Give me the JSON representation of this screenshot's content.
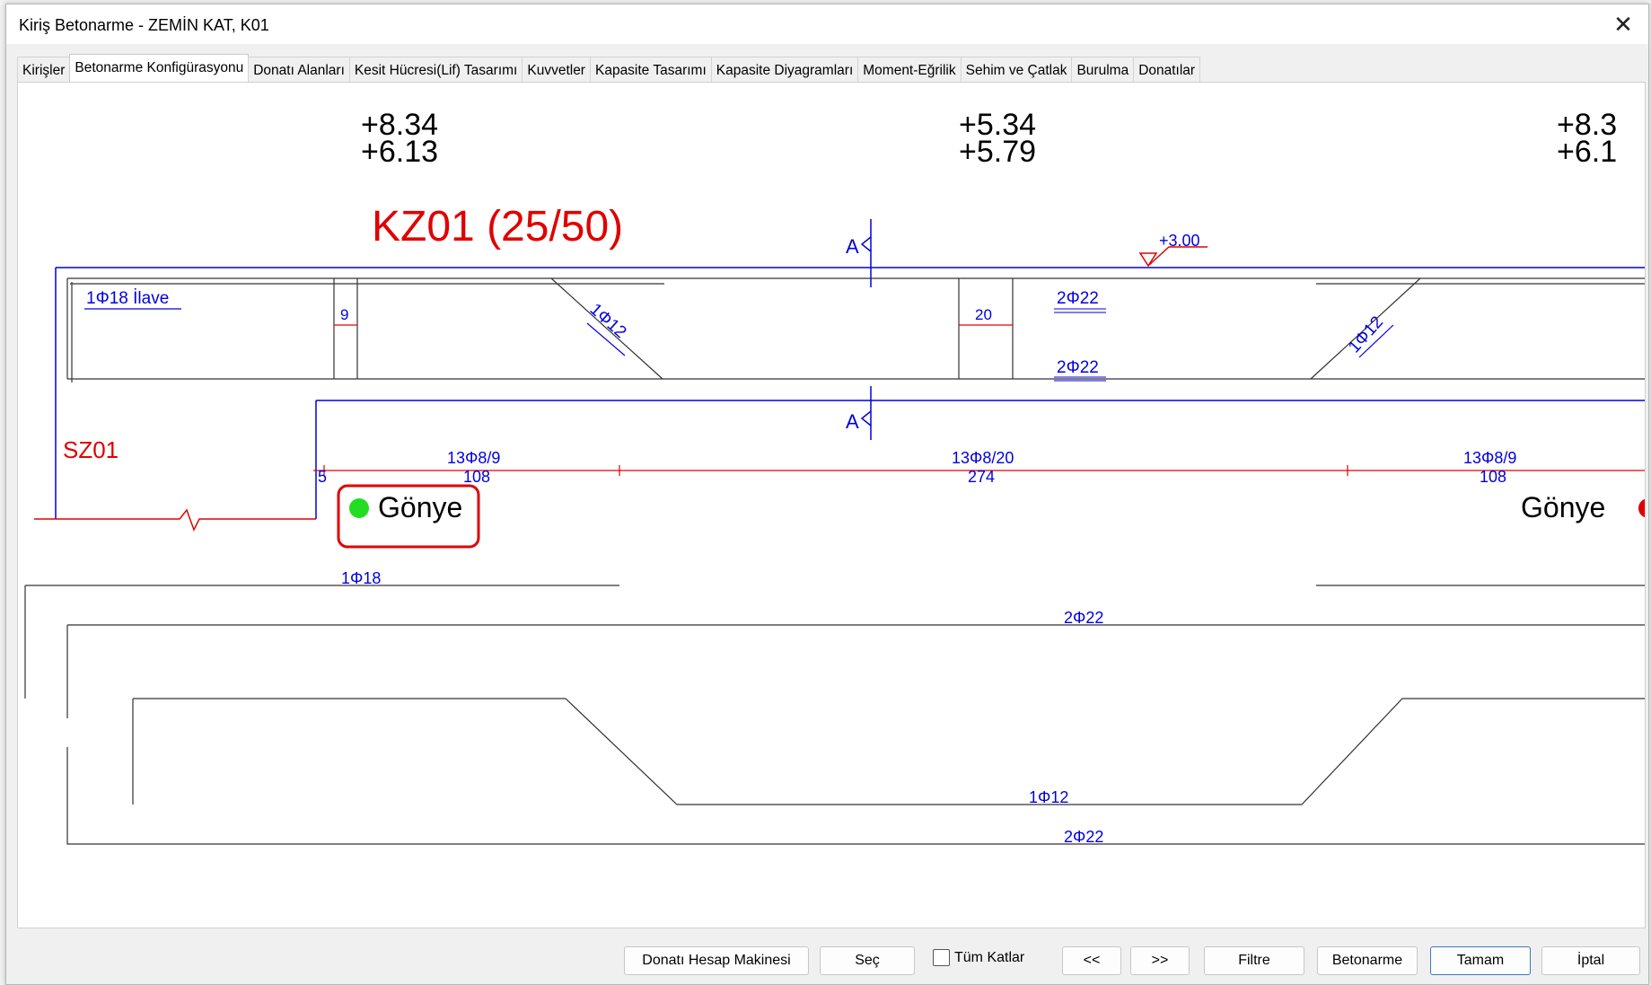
{
  "window": {
    "title": "Kiriş Betonarme - ZEMİN KAT, K01",
    "close": "✕"
  },
  "tabs": [
    "Kirişler",
    "Betonarme Konfigürasyonu",
    "Donatı Alanları",
    "Kesit Hücresi(Lif) Tasarımı",
    "Kuvvetler",
    "Kapasite Tasarımı",
    "Kapasite Diyagramları",
    "Moment-Eğrilik",
    "Sehim ve Çatlak",
    "Burulma",
    "Donatılar"
  ],
  "active_tab": 1,
  "drawing": {
    "top_values": [
      {
        "a": "+8.34",
        "b": "+6.13"
      },
      {
        "a": "+5.34",
        "b": "+5.79"
      },
      {
        "a": "+8.3",
        "b": "+6.1"
      }
    ],
    "beam_title": "KZ01 (25/50)",
    "section_mark": "A",
    "elevation": "+3.00",
    "bar_top_left": "1Φ18 İlave",
    "dim_9": "9",
    "bent_left": "1Φ12",
    "dim_20": "20",
    "bar_2phi22_top": "2Φ22",
    "bar_2phi22_mid": "2Φ22",
    "bent_right": "1Φ12",
    "column_label": "SZ01",
    "stirrup_left": "13Φ8/9",
    "stirrup_left_len": "108",
    "stirrup_mid": "13Φ8/20",
    "stirrup_mid_len": "274",
    "stirrup_right": "13Φ8/9",
    "stirrup_right_len": "108",
    "offset": "5",
    "gonye": "Gönye",
    "detail_1phi18": "1Φ18",
    "detail_2phi22_top": "2Φ22",
    "detail_1phi12": "1Φ12",
    "detail_2phi22_bottom": "2Φ22"
  },
  "buttons": {
    "calc": "Donatı Hesap Makinesi",
    "select": "Seç",
    "all_floors": "Tüm Katlar",
    "prev": "<<",
    "next": ">>",
    "filter": "Filtre",
    "concrete": "Betonarme",
    "ok": "Tamam",
    "cancel": "İptal"
  },
  "colors": {
    "blue": "#0000e0",
    "red": "#e00000",
    "green": "#22dd22"
  }
}
